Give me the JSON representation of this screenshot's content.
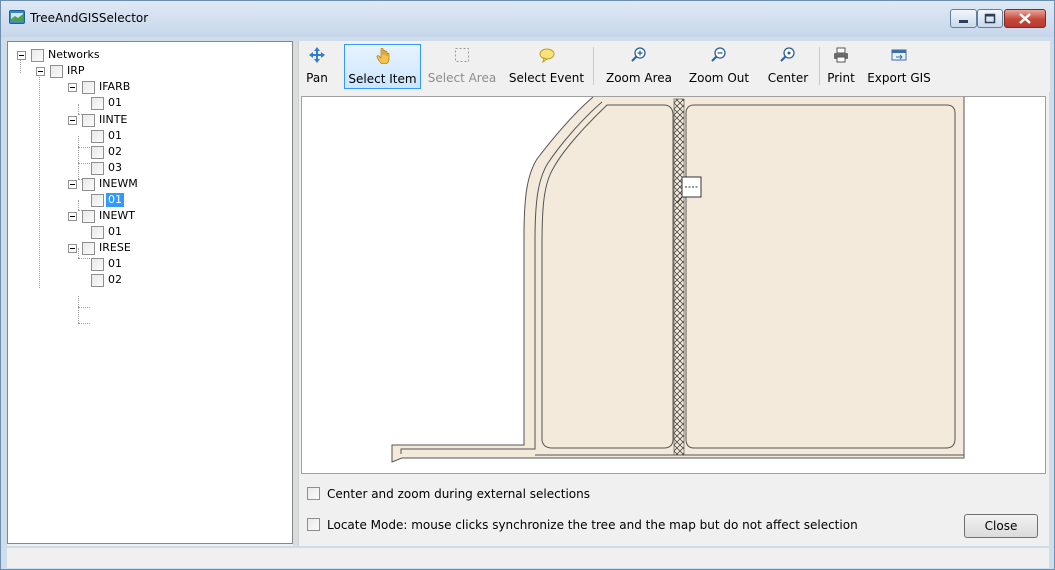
{
  "window": {
    "title": "TreeAndGISSelector"
  },
  "tree": {
    "root": "Networks",
    "group": "IRP",
    "branches": [
      {
        "label": "IFARB",
        "children": [
          "01"
        ]
      },
      {
        "label": "IINTE",
        "children": [
          "01",
          "02",
          "03"
        ]
      },
      {
        "label": "INEWM",
        "children": [
          "01"
        ]
      },
      {
        "label": "INEWT",
        "children": [
          "01"
        ]
      },
      {
        "label": "IRESE",
        "children": [
          "01",
          "02"
        ]
      }
    ],
    "selected": "INEWM / 01"
  },
  "toolbar": {
    "pan": "Pan",
    "select_item": "Select Item",
    "select_area": "Select Area",
    "select_event": "Select Event",
    "zoom_area": "Zoom Area",
    "zoom_out": "Zoom Out",
    "center": "Center",
    "print": "Print",
    "export_gis": "Export GIS"
  },
  "options": {
    "center_zoom": "Center and zoom during external selections",
    "locate_mode": "Locate Mode: mouse clicks synchronize the tree and the map but do not affect selection"
  },
  "buttons": {
    "close": "Close"
  },
  "colors": {
    "parcel_fill": "#f3eadb",
    "selection_highlight": "#3399ff",
    "title_gradient": "#c6d7ea"
  }
}
